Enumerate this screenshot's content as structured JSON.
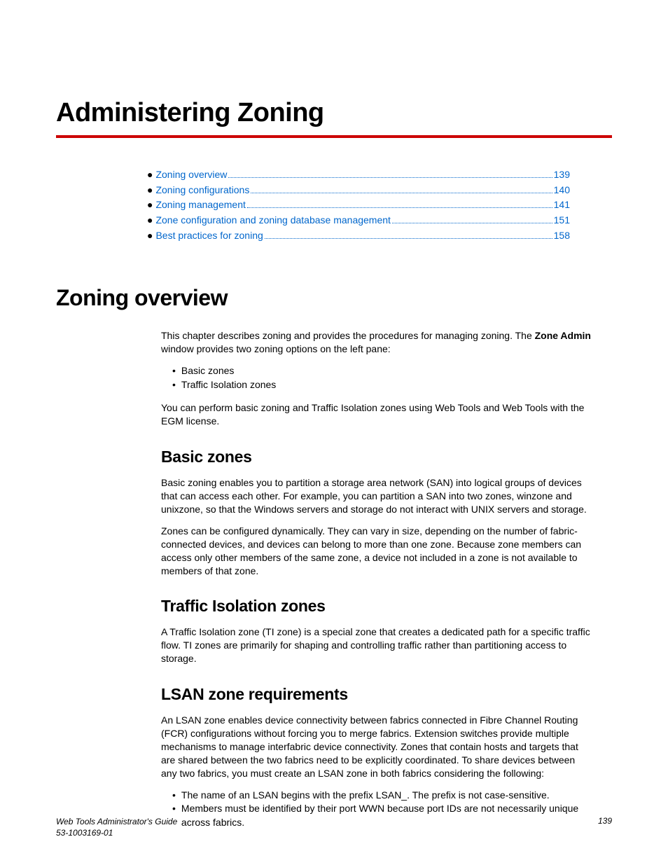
{
  "chapter_title": "Administering Zoning",
  "toc": [
    {
      "label": "Zoning overview",
      "page": "139"
    },
    {
      "label": "Zoning configurations ",
      "page": "140"
    },
    {
      "label": "Zoning management",
      "page": "141"
    },
    {
      "label": "Zone configuration and zoning database management",
      "page": "151"
    },
    {
      "label": "Best practices for zoning",
      "page": "158"
    }
  ],
  "overview": {
    "title": "Zoning overview",
    "intro_pre": "This chapter describes zoning and provides the procedures for managing zoning. The ",
    "intro_bold": "Zone Admin",
    "intro_post": " window provides two zoning options on the left pane:",
    "options": [
      "Basic zones",
      "Traffic Isolation zones"
    ],
    "tail": "You can perform basic zoning and Traffic Isolation zones using Web Tools and Web Tools with the EGM license."
  },
  "basic": {
    "title": "Basic zones",
    "p1": "Basic zoning enables you to partition a storage area network (SAN) into logical groups of devices that can access each other. For example, you can partition a SAN into two zones, winzone and unixzone, so that the Windows servers and storage do not interact with UNIX servers and storage.",
    "p2": "Zones can be configured dynamically. They can vary in size, depending on the number of fabric-connected devices, and devices can belong to more than one zone. Because zone members can access only other members of the same zone, a device not included in a zone is not available to members of that zone."
  },
  "ti": {
    "title": "Traffic Isolation zones",
    "p1": "A Traffic Isolation zone (TI zone) is a special zone that creates a dedicated path for a specific traffic flow. TI zones are primarily for shaping and controlling traffic rather than partitioning access to storage."
  },
  "lsan": {
    "title": "LSAN zone requirements",
    "p1": "An LSAN zone enables device connectivity between fabrics connected in Fibre Channel Routing (FCR) configurations without forcing you to merge fabrics. Extension switches provide multiple mechanisms to manage interfabric device connectivity. Zones that contain hosts and targets that are shared between the two fabrics need to be explicitly coordinated. To share devices between any two fabrics, you must create an LSAN zone in both fabrics considering the following:",
    "items": [
      "The name of an LSAN begins with the prefix LSAN_. The prefix is not case-sensitive.",
      "Members must be identified by their port WWN because port IDs are not necessarily unique across fabrics."
    ]
  },
  "footer": {
    "line1": "Web Tools Administrator's Guide",
    "line2": "53-1003169-01",
    "page": "139"
  }
}
